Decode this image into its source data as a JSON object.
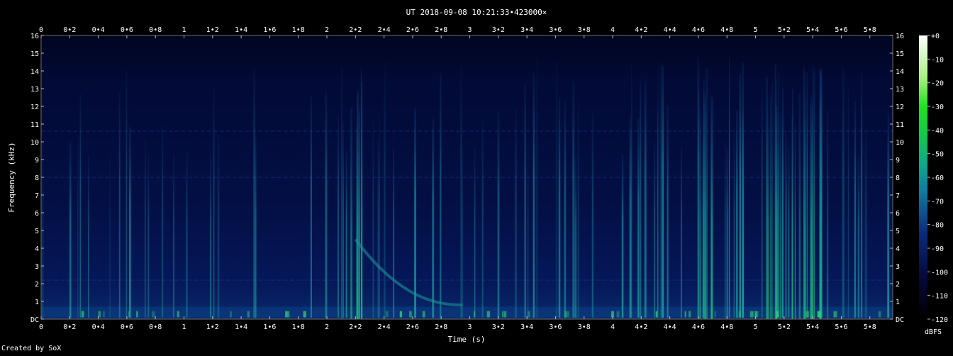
{
  "chart_data": {
    "type": "heatmap",
    "title": "UT 2018-09-08 10:21:33•423000×",
    "xlabel": "Time (s)",
    "ylabel": "Frequency (kHz)",
    "xlim": [
      0,
      5.96
    ],
    "ylim": [
      0,
      16
    ],
    "x_ticks": [
      "0",
      "0•2",
      "0•4",
      "0•6",
      "0•8",
      "1",
      "1•2",
      "1•4",
      "1•6",
      "1•8",
      "2",
      "2•2",
      "2•4",
      "2•6",
      "2•8",
      "3",
      "3•2",
      "3•4",
      "3•6",
      "3•8",
      "4",
      "4•2",
      "4•4",
      "4•6",
      "4•8",
      "5",
      "5•2",
      "5•4",
      "5•6",
      "5•8"
    ],
    "y_ticks": [
      "DC",
      "1",
      "2",
      "3",
      "4",
      "5",
      "6",
      "7",
      "8",
      "9",
      "10",
      "11",
      "12",
      "13",
      "14",
      "15",
      "16"
    ],
    "colorbar": {
      "label": "dBFS",
      "ticks": [
        "+0",
        "-10",
        "-20",
        "-30",
        "-40",
        "-50",
        "-60",
        "-70",
        "-80",
        "-90",
        "-100",
        "-110",
        "-120"
      ],
      "range": [
        -120,
        0
      ]
    },
    "background_color": "#030a2e",
    "energy_regions": [
      {
        "t_start": 2.1,
        "t_end": 2.25,
        "f_max": 14.5,
        "level": "high"
      },
      {
        "t_start": 4.55,
        "t_end": 4.7,
        "f_max": 14.5,
        "level": "high"
      },
      {
        "t_start": 5.05,
        "t_end": 5.5,
        "f_max": 14.5,
        "level": "high"
      }
    ],
    "sweep": {
      "t_start": 2.2,
      "f_start": 4.5,
      "t_end": 2.95,
      "f_end": 0.8
    }
  },
  "footer": {
    "credit": "Created by SoX"
  }
}
